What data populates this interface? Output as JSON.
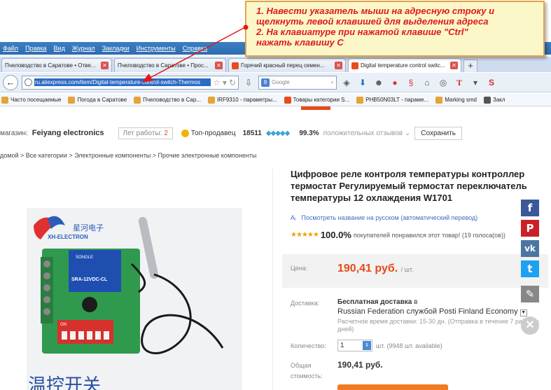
{
  "menu": [
    "Файл",
    "Правка",
    "Вид",
    "Журнал",
    "Закладки",
    "Инструменты",
    "Справка"
  ],
  "tabs": [
    {
      "label": "Пчеловодство в Саратове • Отве..."
    },
    {
      "label": "Пчеловодство в Саратове • Прос..."
    },
    {
      "label": "Горячий красный перец семен..."
    },
    {
      "label": "Digital temperature control switc..."
    }
  ],
  "tab_add": "+",
  "nav": {
    "url": "ru.aliexpress.com/item/Digital-temperature-control-switch-Thermos",
    "search_placeholder": "Google"
  },
  "bookmarks": [
    "Часто посещаемые",
    "Погода в Саратове",
    "Пчеловодство в Сар...",
    "IRF9310 - параметры...",
    "Товары категории S...",
    "PHB50N03LT - параме...",
    "Marking smd",
    "Закл"
  ],
  "callout": {
    "line1": "1. Навести указатель мыши на адресную строку и",
    "line2": "щелкнуть левой клавишей для выделения адреса",
    "line3": "2. На клавиатуре при нажатой клавише \"Ctrl\"",
    "line4": "нажать клавишу С"
  },
  "store": {
    "label": "магазин:",
    "name": "Feiyang electronics",
    "years_label": "Лет работы:",
    "years": "2",
    "top_seller": "Топ-продавец",
    "score": "18511",
    "pos_pct": "99.3%",
    "pos_text": "положительных отзывов",
    "save": "Сохранить"
  },
  "breadcrumb": "домой > Все категории > Электронные компоненты > Прочие электронные компоненты",
  "product": {
    "title_l1": "Цифровое реле контроля температуры контроллер",
    "title_l2": "термостат Регулируемый термостат переключатель",
    "title_l3": "температуры 12 охлаждения W1701",
    "translate": "Посмотреть название на русском (автоматический перевод)",
    "rating_pct": "100.0%",
    "rating_text": "покупателей понравился этот товар! (19 голоса(ов))",
    "price_label": "Цена:",
    "price": "190,41 руб.",
    "price_unit": "/ шт.",
    "ship_label": "Доставка:",
    "ship_title": "Бесплатная доставка",
    "ship_in": "в",
    "ship_line": "Russian Federation службой Posti Finland Economy",
    "ship_note": "Расчетное время доставки: 15-30 дн. (Отправка в течение 7 рабочих дней)",
    "qty_label": "Количество:",
    "qty": "1",
    "qty_note": "шт. (9948 шт. available)",
    "total_label": "Общая стоимость:",
    "total": "190,41 руб."
  },
  "image_text": {
    "brand": "XH-ELECTRON",
    "brand_cn": "星河电子",
    "relay": "SRA-12VDC-CL",
    "songle": "SONGLE",
    "on": "ON",
    "bottom": "温控开关"
  },
  "social": [
    {
      "name": "facebook",
      "glyph": "f",
      "color": "#3b5998"
    },
    {
      "name": "pinterest",
      "glyph": "P",
      "color": "#cb2027"
    },
    {
      "name": "vk",
      "glyph": "vk",
      "color": "#4c75a3"
    },
    {
      "name": "twitter",
      "glyph": "t",
      "color": "#1da1f2"
    },
    {
      "name": "edit",
      "glyph": "✎",
      "color": "#888888"
    }
  ],
  "close": "✕"
}
